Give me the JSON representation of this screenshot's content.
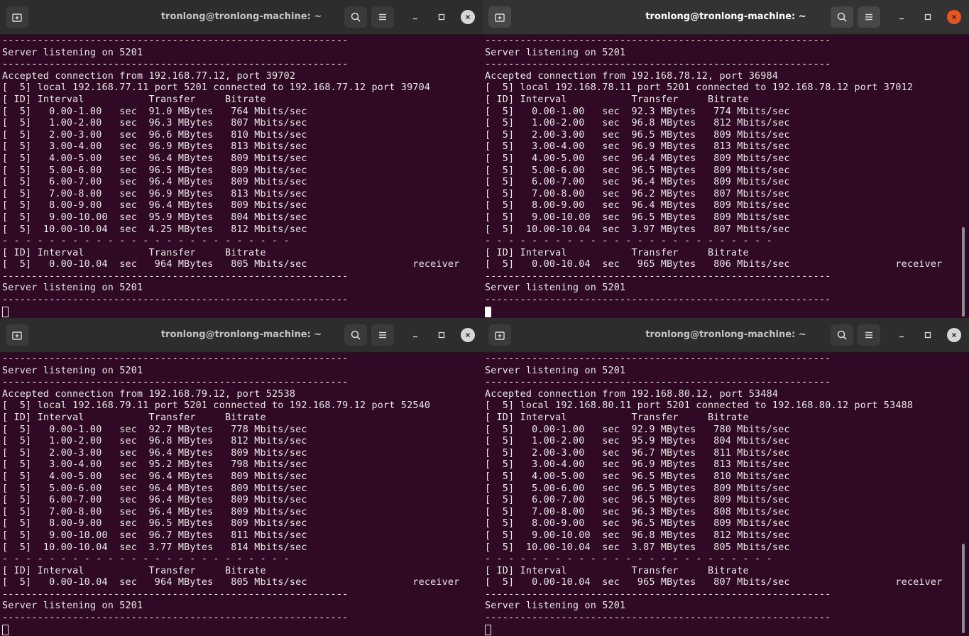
{
  "windows": [
    {
      "id": "tl",
      "title": "tronlong@tronlong-machine: ~",
      "active": false,
      "lines": [
        "-----------------------------------------------------------",
        "Server listening on 5201",
        "-----------------------------------------------------------",
        "Accepted connection from 192.168.77.12, port 39702",
        "[  5] local 192.168.77.11 port 5201 connected to 192.168.77.12 port 39704",
        "[ ID] Interval           Transfer     Bitrate",
        "[  5]   0.00-1.00   sec  91.0 MBytes   764 Mbits/sec",
        "[  5]   1.00-2.00   sec  96.3 MBytes   807 Mbits/sec",
        "[  5]   2.00-3.00   sec  96.6 MBytes   810 Mbits/sec",
        "[  5]   3.00-4.00   sec  96.9 MBytes   813 Mbits/sec",
        "[  5]   4.00-5.00   sec  96.4 MBytes   809 Mbits/sec",
        "[  5]   5.00-6.00   sec  96.5 MBytes   809 Mbits/sec",
        "[  5]   6.00-7.00   sec  96.4 MBytes   809 Mbits/sec",
        "[  5]   7.00-8.00   sec  96.9 MBytes   813 Mbits/sec",
        "[  5]   8.00-9.00   sec  96.4 MBytes   809 Mbits/sec",
        "[  5]   9.00-10.00  sec  95.9 MBytes   804 Mbits/sec",
        "[  5]  10.00-10.04  sec  4.25 MBytes   812 Mbits/sec",
        "- - - - - - - - - - - - - - - - - - - - - - - - -",
        "[ ID] Interval           Transfer     Bitrate",
        "[  5]   0.00-10.04  sec   964 MBytes   805 Mbits/sec                  receiver",
        "-----------------------------------------------------------",
        "Server listening on 5201",
        "-----------------------------------------------------------"
      ]
    },
    {
      "id": "tr",
      "title": "tronlong@tronlong-machine: ~",
      "active": true,
      "lines": [
        "-----------------------------------------------------------",
        "Server listening on 5201",
        "-----------------------------------------------------------",
        "Accepted connection from 192.168.78.12, port 36984",
        "[  5] local 192.168.78.11 port 5201 connected to 192.168.78.12 port 37012",
        "[ ID] Interval           Transfer     Bitrate",
        "[  5]   0.00-1.00   sec  92.3 MBytes   774 Mbits/sec",
        "[  5]   1.00-2.00   sec  96.8 MBytes   812 Mbits/sec",
        "[  5]   2.00-3.00   sec  96.5 MBytes   809 Mbits/sec",
        "[  5]   3.00-4.00   sec  96.9 MBytes   813 Mbits/sec",
        "[  5]   4.00-5.00   sec  96.4 MBytes   809 Mbits/sec",
        "[  5]   5.00-6.00   sec  96.5 MBytes   809 Mbits/sec",
        "[  5]   6.00-7.00   sec  96.4 MBytes   809 Mbits/sec",
        "[  5]   7.00-8.00   sec  96.2 MBytes   807 Mbits/sec",
        "[  5]   8.00-9.00   sec  96.4 MBytes   809 Mbits/sec",
        "[  5]   9.00-10.00  sec  96.5 MBytes   809 Mbits/sec",
        "[  5]  10.00-10.04  sec  3.97 MBytes   807 Mbits/sec",
        "- - - - - - - - - - - - - - - - - - - - - - - - -",
        "[ ID] Interval           Transfer     Bitrate",
        "[  5]   0.00-10.04  sec   965 MBytes   806 Mbits/sec                  receiver",
        "-----------------------------------------------------------",
        "Server listening on 5201",
        "-----------------------------------------------------------"
      ]
    },
    {
      "id": "bl",
      "title": "tronlong@tronlong-machine: ~",
      "active": false,
      "lines": [
        "-----------------------------------------------------------",
        "Server listening on 5201",
        "-----------------------------------------------------------",
        "Accepted connection from 192.168.79.12, port 52538",
        "[  5] local 192.168.79.11 port 5201 connected to 192.168.79.12 port 52540",
        "[ ID] Interval           Transfer     Bitrate",
        "[  5]   0.00-1.00   sec  92.7 MBytes   778 Mbits/sec",
        "[  5]   1.00-2.00   sec  96.8 MBytes   812 Mbits/sec",
        "[  5]   2.00-3.00   sec  96.4 MBytes   809 Mbits/sec",
        "[  5]   3.00-4.00   sec  95.2 MBytes   798 Mbits/sec",
        "[  5]   4.00-5.00   sec  96.4 MBytes   809 Mbits/sec",
        "[  5]   5.00-6.00   sec  96.4 MBytes   809 Mbits/sec",
        "[  5]   6.00-7.00   sec  96.4 MBytes   809 Mbits/sec",
        "[  5]   7.00-8.00   sec  96.4 MBytes   809 Mbits/sec",
        "[  5]   8.00-9.00   sec  96.5 MBytes   809 Mbits/sec",
        "[  5]   9.00-10.00  sec  96.7 MBytes   811 Mbits/sec",
        "[  5]  10.00-10.04  sec  3.77 MBytes   814 Mbits/sec",
        "- - - - - - - - - - - - - - - - - - - - - - - - -",
        "[ ID] Interval           Transfer     Bitrate",
        "[  5]   0.00-10.04  sec   964 MBytes   805 Mbits/sec                  receiver",
        "-----------------------------------------------------------",
        "Server listening on 5201",
        "-----------------------------------------------------------"
      ]
    },
    {
      "id": "br",
      "title": "tronlong@tronlong-machine: ~",
      "active": false,
      "lines": [
        "-----------------------------------------------------------",
        "Server listening on 5201",
        "-----------------------------------------------------------",
        "Accepted connection from 192.168.80.12, port 53484",
        "[  5] local 192.168.80.11 port 5201 connected to 192.168.80.12 port 53488",
        "[ ID] Interval           Transfer     Bitrate",
        "[  5]   0.00-1.00   sec  92.9 MBytes   780 Mbits/sec",
        "[  5]   1.00-2.00   sec  95.9 MBytes   804 Mbits/sec",
        "[  5]   2.00-3.00   sec  96.7 MBytes   811 Mbits/sec",
        "[  5]   3.00-4.00   sec  96.9 MBytes   813 Mbits/sec",
        "[  5]   4.00-5.00   sec  96.5 MBytes   810 Mbits/sec",
        "[  5]   5.00-6.00   sec  96.5 MBytes   809 Mbits/sec",
        "[  5]   6.00-7.00   sec  96.5 MBytes   809 Mbits/sec",
        "[  5]   7.00-8.00   sec  96.3 MBytes   808 Mbits/sec",
        "[  5]   8.00-9.00   sec  96.5 MBytes   809 Mbits/sec",
        "[  5]   9.00-10.00  sec  96.8 MBytes   812 Mbits/sec",
        "[  5]  10.00-10.04  sec  3.87 MBytes   805 Mbits/sec",
        "- - - - - - - - - - - - - - - - - - - - - - - - -",
        "[ ID] Interval           Transfer     Bitrate",
        "[  5]   0.00-10.04  sec   965 MBytes   807 Mbits/sec                  receiver",
        "-----------------------------------------------------------",
        "Server listening on 5201",
        "-----------------------------------------------------------"
      ]
    }
  ],
  "icons": {
    "new_tab": "new-tab-icon",
    "search": "search-icon",
    "menu": "hamburger-menu-icon",
    "minimize": "minimize-icon",
    "maximize": "maximize-icon",
    "close": "close-icon"
  },
  "colors": {
    "terminal_bg": "#300a24",
    "titlebar_bg": "#2d2d2d",
    "close_active": "#e95420",
    "text": "#e8e8e8"
  }
}
